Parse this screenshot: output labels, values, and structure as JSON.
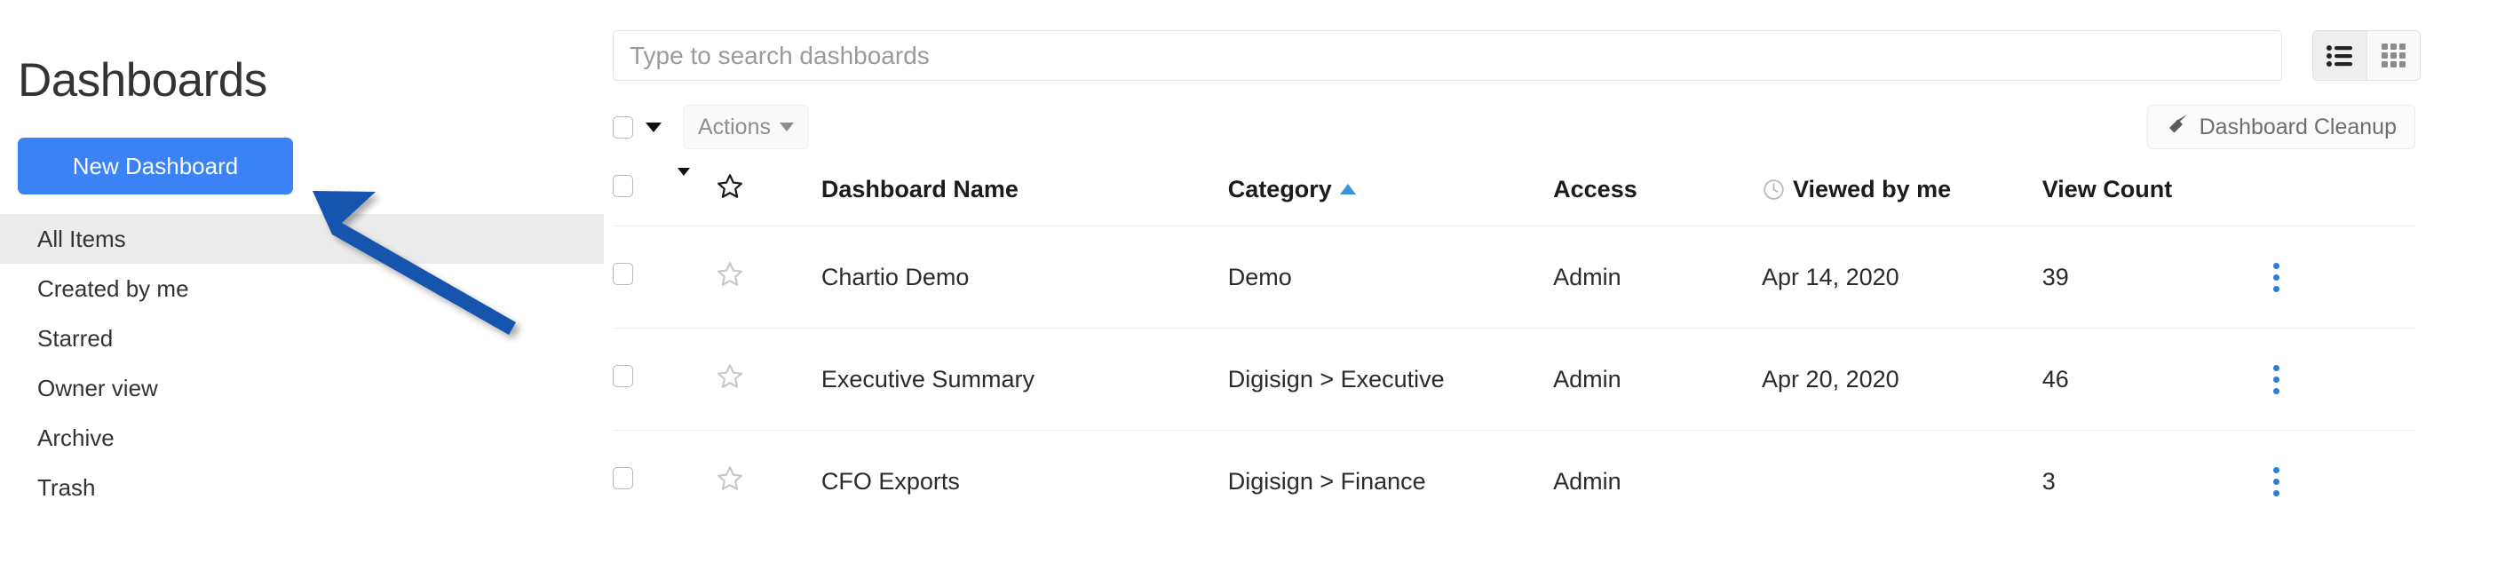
{
  "sidebar": {
    "title": "Dashboards",
    "new_dashboard_label": "New Dashboard",
    "items": [
      {
        "label": "All Items",
        "active": true
      },
      {
        "label": "Created by me",
        "active": false
      },
      {
        "label": "Starred",
        "active": false
      },
      {
        "label": "Owner view",
        "active": false
      },
      {
        "label": "Archive",
        "active": false
      },
      {
        "label": "Trash",
        "active": false
      }
    ]
  },
  "search": {
    "placeholder": "Type to search dashboards",
    "value": ""
  },
  "view_toggle": {
    "list_icon": "list-view-icon",
    "grid_icon": "grid-view-icon",
    "active": "list"
  },
  "toolbar": {
    "select_all_checked": false,
    "actions_label": "Actions",
    "dropdown_caret_icon": "caret-down-icon",
    "cleanup_label": "Dashboard Cleanup",
    "cleanup_icon": "broom-icon"
  },
  "table": {
    "columns": [
      {
        "key": "checkbox",
        "label": ""
      },
      {
        "key": "caret",
        "label": ""
      },
      {
        "key": "star",
        "label": ""
      },
      {
        "key": "name",
        "label": "Dashboard Name"
      },
      {
        "key": "category",
        "label": "Category",
        "sort": "asc",
        "sort_color": "#3b93d9"
      },
      {
        "key": "access",
        "label": "Access"
      },
      {
        "key": "viewed",
        "label": "Viewed by me",
        "icon": "clock-icon"
      },
      {
        "key": "count",
        "label": "View Count"
      },
      {
        "key": "menu",
        "label": ""
      }
    ],
    "rows": [
      {
        "checked": false,
        "starred": false,
        "name": "Chartio Demo",
        "category": "Demo",
        "access": "Admin",
        "viewed": "Apr 14, 2020",
        "count": "39"
      },
      {
        "checked": false,
        "starred": false,
        "name": "Executive Summary",
        "category": "Digisign > Executive",
        "access": "Admin",
        "viewed": "Apr 20, 2020",
        "count": "46"
      },
      {
        "checked": false,
        "starred": false,
        "name": "CFO Exports",
        "category": "Digisign > Finance",
        "access": "Admin",
        "viewed": "",
        "count": "3"
      }
    ]
  },
  "annotation": {
    "arrow_icon": "annotation-arrow-icon",
    "color": "#1254ad",
    "points_to": "new-dashboard-button"
  },
  "colors": {
    "primary_button": "#3b82f6",
    "active_nav": "#ececec",
    "sort_indicator": "#3b93d9",
    "kebab": "#2d7dd2",
    "annotation_arrow": "#1254ad"
  }
}
